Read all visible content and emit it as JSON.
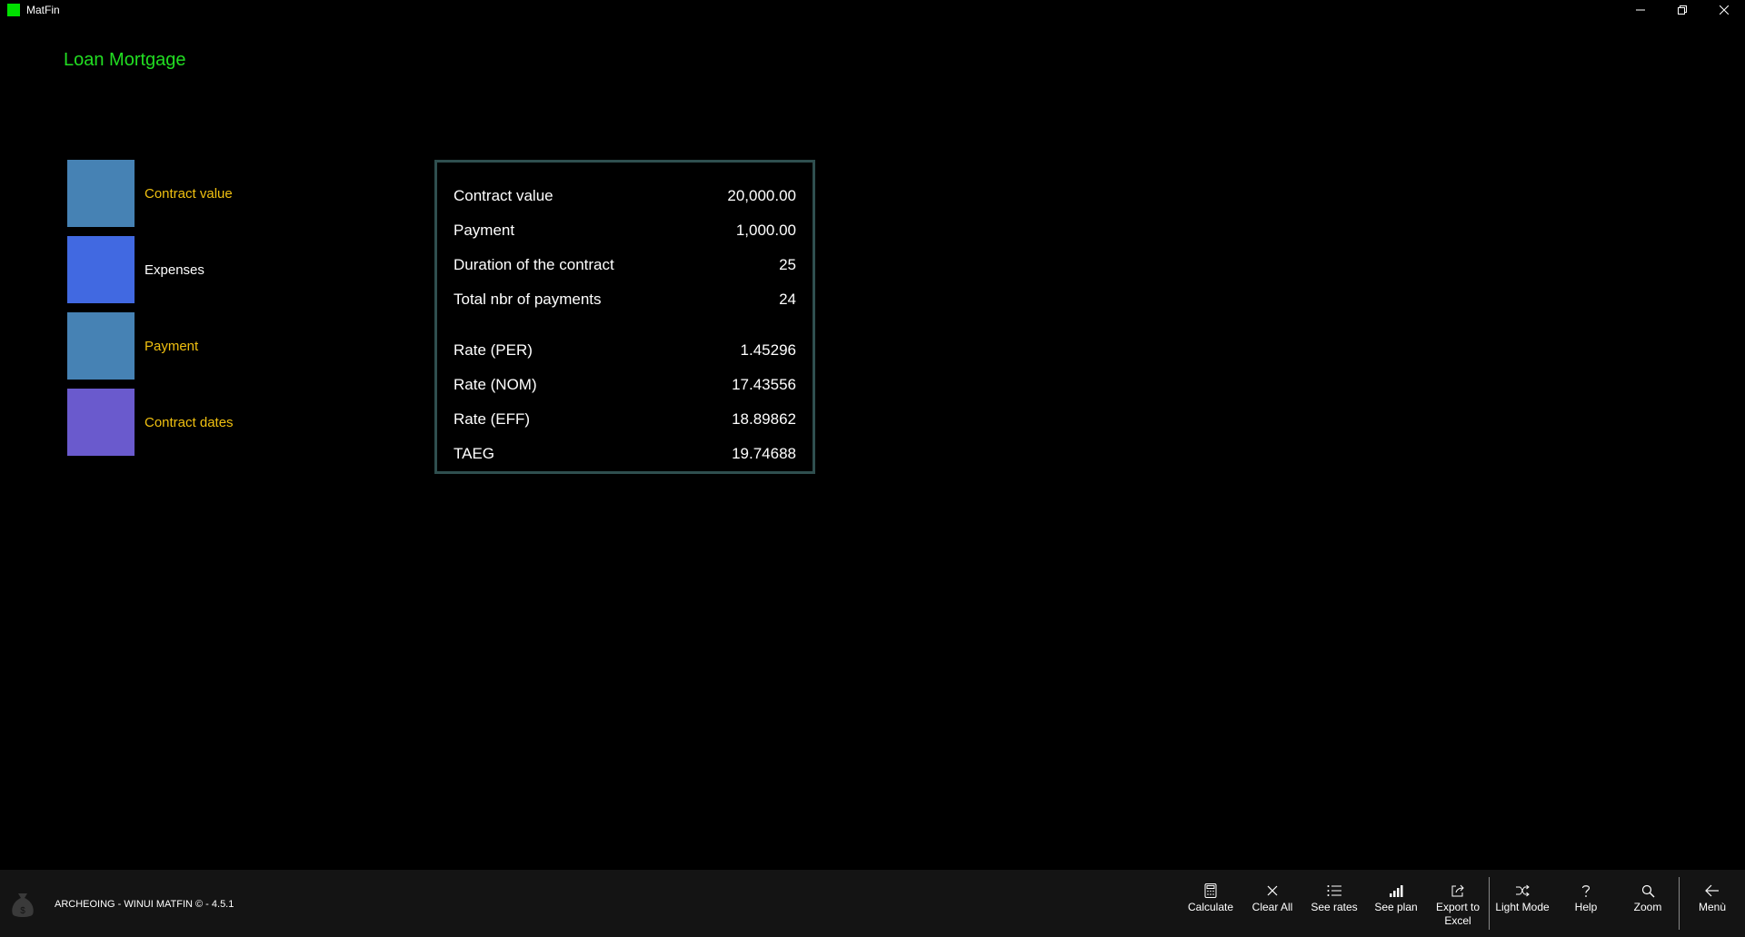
{
  "window": {
    "title": "MatFin",
    "app_icon_color": "#00e000"
  },
  "page": {
    "title": "Loan Mortgage"
  },
  "tiles": [
    {
      "label": "Contract value",
      "color": "#4682b4",
      "label_color": "#f0c010",
      "icon": "square-tile"
    },
    {
      "label": "Expenses",
      "color": "#4169e1",
      "label_color": "#ffffff",
      "icon": "square-tile"
    },
    {
      "label": "Payment",
      "color": "#4682b4",
      "label_color": "#f0c010",
      "icon": "square-tile"
    },
    {
      "label": "Contract dates",
      "color": "#6a5acd",
      "label_color": "#f0c010",
      "icon": "square-tile"
    }
  ],
  "summary": {
    "rows": [
      {
        "label": "Contract value",
        "value": "20,000.00"
      },
      {
        "label": "Payment",
        "value": "1,000.00"
      },
      {
        "label": "Duration of the contract",
        "value": "25"
      },
      {
        "label": "Total nbr of payments",
        "value": "24"
      },
      {
        "label": "Rate (PER)",
        "value": "1.45296"
      },
      {
        "label": "Rate (NOM)",
        "value": "17.43556"
      },
      {
        "label": "Rate (EFF)",
        "value": "18.89862"
      },
      {
        "label": "TAEG",
        "value": "19.74688"
      }
    ]
  },
  "footer": {
    "version": "ARCHEOING - WINUI MATFIN © - 4.5.1",
    "commands": {
      "calculate": "Calculate",
      "clear_all": "Clear All",
      "see_rates": "See rates",
      "see_plan": "See plan",
      "export_line1": "Export to",
      "export_line2": "Excel",
      "light_mode": "Light Mode",
      "help": "Help",
      "zoom": "Zoom",
      "menu": "Menù"
    }
  }
}
